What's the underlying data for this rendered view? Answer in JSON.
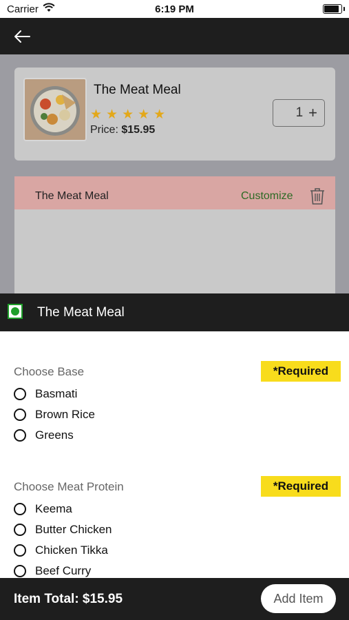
{
  "status_bar": {
    "carrier": "Carrier",
    "time": "6:19 PM"
  },
  "nav": {
    "back_icon": "arrow-left-icon"
  },
  "product": {
    "title": "The Meat Meal",
    "rating": 5,
    "stars": "★★★★★",
    "price_label": "Price:",
    "price_value": "$15.95",
    "quantity": "1",
    "plus": "+",
    "star_color": "#e3a81a"
  },
  "cart": {
    "item_name": "The Meat Meal",
    "customize_label": "Customize",
    "delete_icon": "trash-icon"
  },
  "sheet": {
    "title": "The Meat Meal",
    "veg_icon": "veg-indicator-icon",
    "sections": [
      {
        "title": "Choose Base",
        "badge": "*Required",
        "options": [
          "Basmati",
          "Brown Rice",
          "Greens"
        ]
      },
      {
        "title": "Choose Meat Protein",
        "badge": "*Required",
        "options": [
          "Keema",
          "Butter Chicken",
          "Chicken Tikka",
          "Beef Curry"
        ]
      }
    ]
  },
  "footer": {
    "total_label": "Item Total: $15.95",
    "add_button": "Add Item"
  },
  "colors": {
    "badge": "#f8dc1c",
    "customize": "#2c6a24",
    "cart_row": "#d9a6a3",
    "dark_bar": "#1e1e1e"
  }
}
